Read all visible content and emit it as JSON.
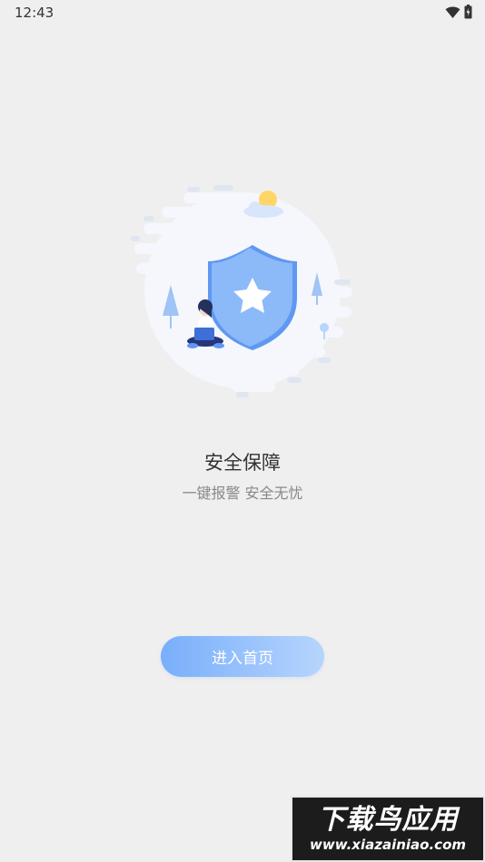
{
  "status_bar": {
    "time": "12:43",
    "icons": [
      "wifi-icon",
      "battery-icon"
    ]
  },
  "illustration": {
    "name": "security-shield-illustration",
    "colors": {
      "shield": "#8cb9f8",
      "shield_dark": "#5f98f2",
      "sun": "#ffd666",
      "blob": "#f5f7fc"
    }
  },
  "content": {
    "title": "安全保障",
    "subtitle": "一键报警 安全无忧"
  },
  "button": {
    "label": "进入首页",
    "gradient_start": "#79aefb",
    "gradient_end": "#b6d5fc"
  },
  "watermark": {
    "main": "下载鸟应用",
    "sub": "www.xiazainiao.com"
  }
}
